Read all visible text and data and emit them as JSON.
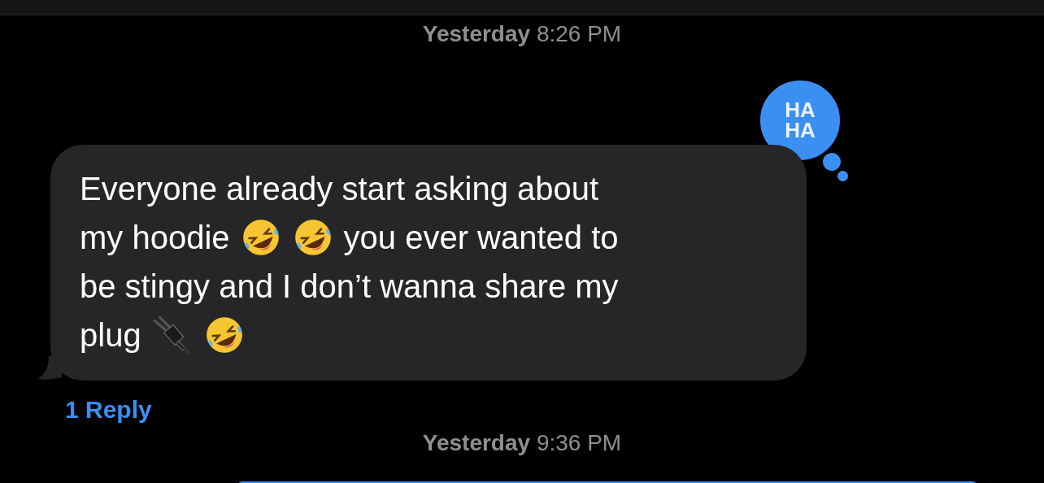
{
  "thread": [
    {
      "kind": "timestamp",
      "day": "Yesterday",
      "time": "8:26 PM"
    },
    {
      "kind": "incoming",
      "reaction": {
        "lines": [
          "HA",
          "HA"
        ]
      },
      "lines": [
        [
          {
            "kind": "text",
            "text": "Everyone already start asking about"
          }
        ],
        [
          {
            "kind": "text",
            "text": "my hoodie"
          },
          {
            "kind": "laugh-emoji"
          },
          {
            "kind": "laugh-emoji"
          },
          {
            "kind": "text",
            "text": "you ever wanted to"
          }
        ],
        [
          {
            "kind": "text",
            "text": "be stingy and I don’t wanna share my"
          }
        ],
        [
          {
            "kind": "text",
            "text": "plug"
          },
          {
            "kind": "plug-emoji"
          },
          {
            "kind": "laugh-emoji"
          }
        ]
      ],
      "replies": "1 Reply"
    },
    {
      "kind": "timestamp",
      "day": "Yesterday",
      "time": "9:36 PM"
    },
    {
      "kind": "outgoing"
    }
  ]
}
